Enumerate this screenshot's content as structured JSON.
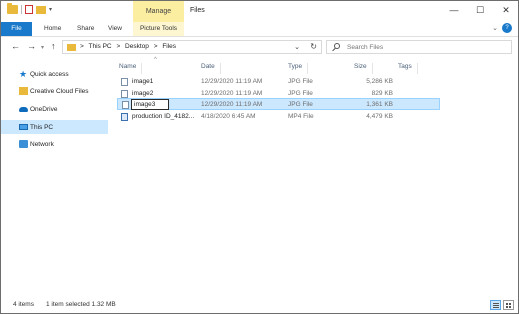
{
  "window": {
    "title": "Files",
    "manage_tab": "Manage",
    "minimize": "—",
    "maximize": "☐",
    "close": "✕"
  },
  "ribbon": {
    "tabs": [
      {
        "label": "File"
      },
      {
        "label": "Home"
      },
      {
        "label": "Share"
      },
      {
        "label": "View"
      },
      {
        "label": "Picture Tools"
      }
    ],
    "expand_icon": "chevron-down-icon",
    "help_icon": "help-icon"
  },
  "nav": {
    "back": "←",
    "forward": "→",
    "recent": "▾",
    "up": "↑"
  },
  "address": {
    "crumbs": [
      ">",
      "This PC",
      ">",
      "Desktop",
      ">",
      "Files"
    ],
    "dropdown": "⌄",
    "refresh": "↻"
  },
  "search": {
    "placeholder": "Search Files"
  },
  "navpane": {
    "items": [
      {
        "label": "Quick access",
        "icon": "star-icon"
      },
      {
        "label": "Creative Cloud Files",
        "icon": "creative-cloud-folder-icon"
      },
      {
        "label": "OneDrive",
        "icon": "cloud-icon"
      },
      {
        "label": "This PC",
        "icon": "computer-icon",
        "selected": true
      },
      {
        "label": "Network",
        "icon": "network-icon"
      }
    ]
  },
  "columns": {
    "sort_indicator": "^",
    "name": "Name",
    "date": "Date",
    "type": "Type",
    "size": "Size",
    "tags": "Tags"
  },
  "files": [
    {
      "name": "image1",
      "date": "12/29/2020 11:19 AM",
      "type": "JPG File",
      "size": "5,286 KB",
      "icon": "image-file-icon"
    },
    {
      "name": "image2",
      "date": "12/29/2020 11:19 AM",
      "type": "JPG File",
      "size": "829 KB",
      "icon": "image-file-icon"
    },
    {
      "name": "image3",
      "date": "12/29/2020 11:19 AM",
      "type": "JPG File",
      "size": "1,361 KB",
      "icon": "image-file-icon",
      "selected": true,
      "renaming": true
    },
    {
      "name": "production ID_4182...",
      "date": "4/18/2020 6:45 AM",
      "type": "MP4 File",
      "size": "4,479 KB",
      "icon": "video-file-icon"
    }
  ],
  "status": {
    "item_count": "4 items",
    "selection": "1 item selected  1.32 MB"
  }
}
